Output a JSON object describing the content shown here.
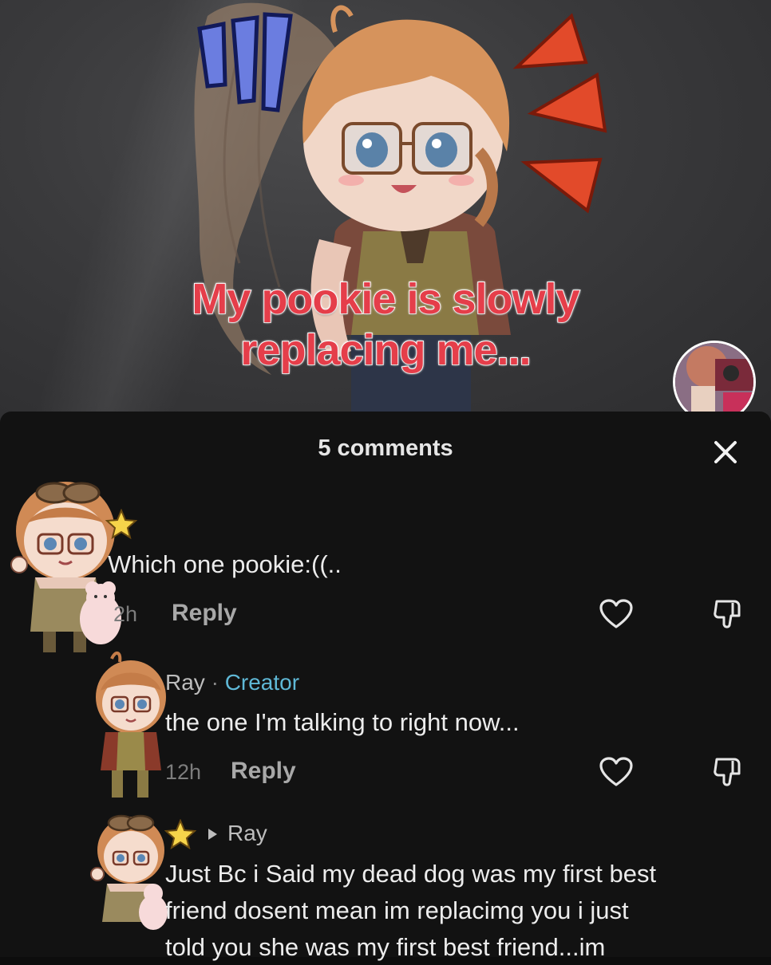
{
  "video": {
    "caption_line1": "My pookie is slowly",
    "caption_line2": "replacing me..."
  },
  "comments_panel": {
    "title": "5 comments",
    "close_label": "✕"
  },
  "comments": [
    {
      "text": "Which one pookie:((..",
      "time": "2h",
      "reply_label": "Reply"
    },
    {
      "author": "Ray",
      "separator": "·",
      "badge": "Creator",
      "text": "the one I'm talking to right now...",
      "time": "12h",
      "reply_label": "Reply"
    },
    {
      "reply_to": "Ray",
      "text_line1": "Just Bc i Said my dead dog was my first best",
      "text_line2": "friend dosent mean im replacimg you i just",
      "text_line3": "told you she was my first best friend...im"
    }
  ],
  "icons": {
    "like": "heart-outline-icon",
    "dislike": "thumbs-down-icon",
    "close": "close-icon",
    "star": "star-icon",
    "caret": "caret-right-icon"
  },
  "colors": {
    "caption": "#e53e4a",
    "creator_badge": "#5fb8d6",
    "sheet_bg": "#121212"
  }
}
